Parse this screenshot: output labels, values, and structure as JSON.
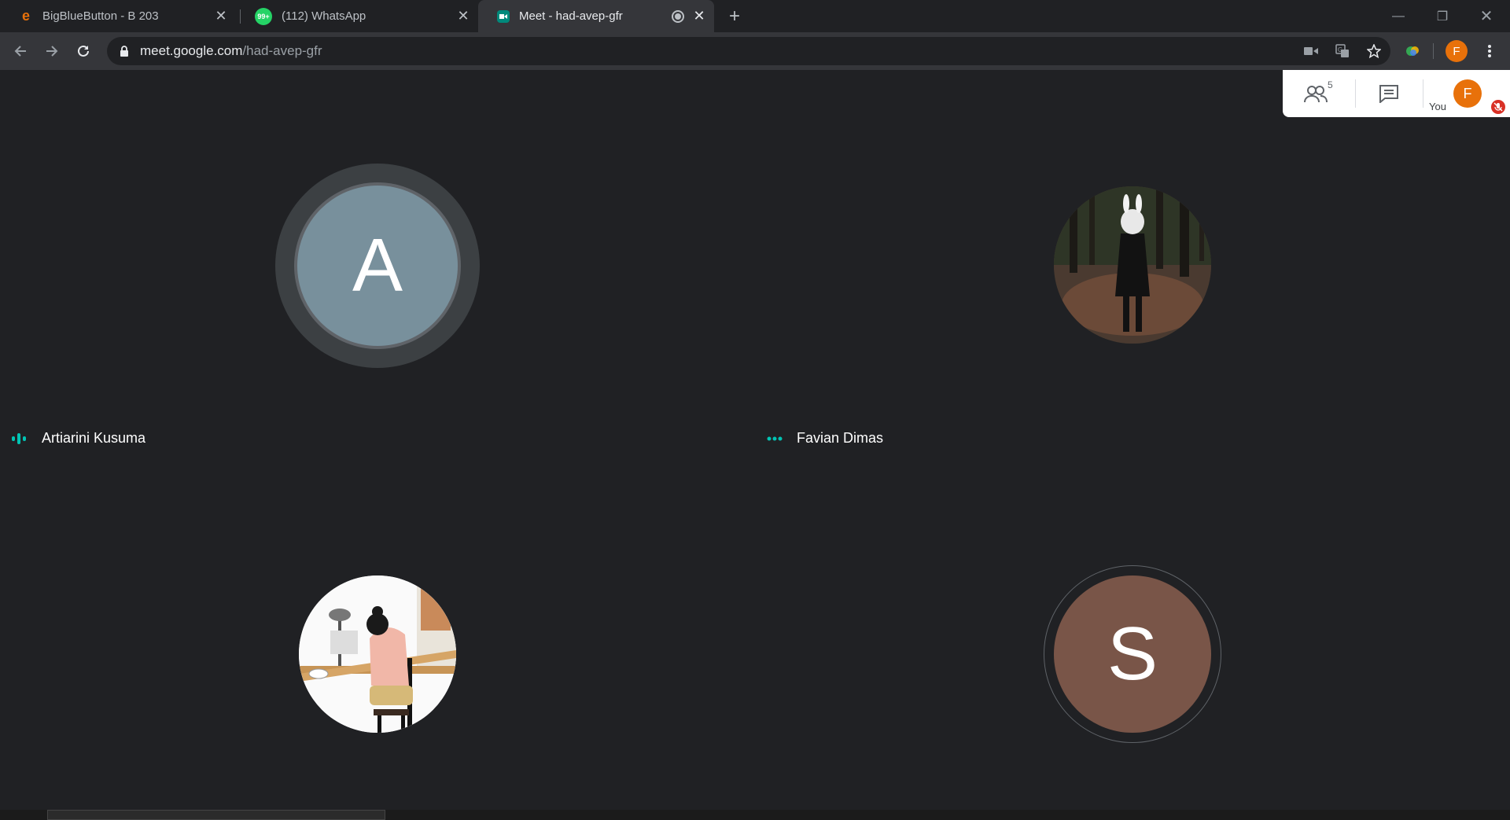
{
  "browser": {
    "tabs": [
      {
        "title": "BigBlueButton - B 203",
        "favicon": "bigbluebutton-icon",
        "active": false
      },
      {
        "title": "(112) WhatsApp",
        "favicon": "whatsapp-icon",
        "badge": "99+",
        "active": false
      },
      {
        "title": "Meet - had-avep-gfr",
        "favicon": "meet-icon",
        "active": true,
        "recording": true
      }
    ],
    "url_host": "meet.google.com",
    "url_path": "/had-avep-gfr",
    "profile_initial": "F"
  },
  "meet": {
    "participants_count": "5",
    "self_label": "You",
    "self_initial": "F",
    "tiles": [
      {
        "name": "Artiarini Kusuma",
        "avatar_type": "letter",
        "initial": "A",
        "color": "#78909c",
        "speaking": true
      },
      {
        "name": "Favian Dimas",
        "avatar_type": "photo",
        "photo": "rabbit-mask-forest-photo",
        "speaking": false,
        "more": true
      },
      {
        "name": "",
        "avatar_type": "photo",
        "photo": "girl-at-desk-illustration"
      },
      {
        "name": "",
        "avatar_type": "letter",
        "initial": "S",
        "color": "#795548"
      }
    ]
  },
  "colors": {
    "accent": "#1a73e8",
    "speaking": "#00c4b4",
    "profile": "#e8710a",
    "mute": "#d93025"
  }
}
